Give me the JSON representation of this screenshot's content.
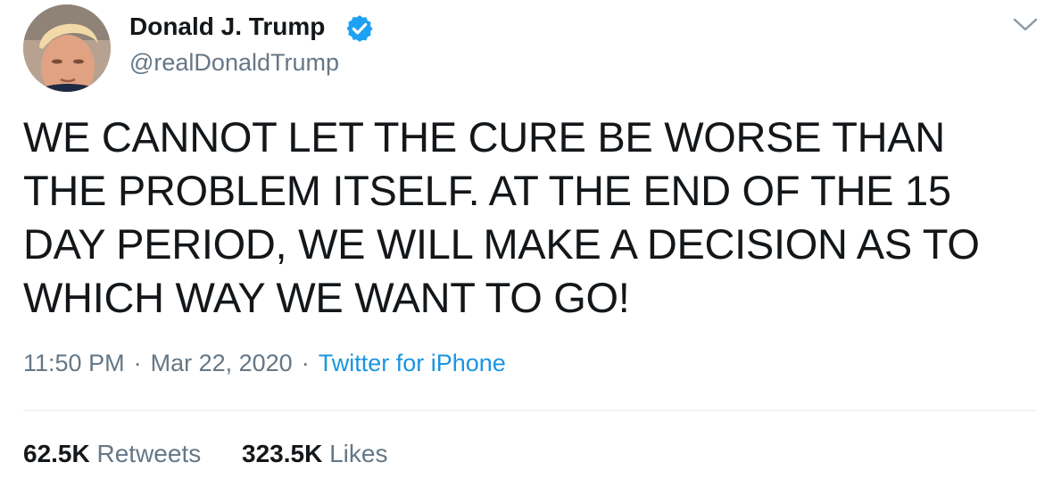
{
  "user": {
    "display_name": "Donald J. Trump",
    "handle": "@realDonaldTrump",
    "verified": true,
    "avatar_icon": "profile-photo"
  },
  "tweet": {
    "text": "WE CANNOT LET THE CURE BE WORSE THAN THE PROBLEM ITSELF. AT THE END OF THE 15 DAY PERIOD, WE WILL MAKE A DECISION AS TO WHICH WAY WE WANT TO GO!"
  },
  "meta": {
    "time": "11:50 PM",
    "separator": "·",
    "date": "Mar 22, 2020",
    "source": "Twitter for iPhone"
  },
  "stats": {
    "retweets_count": "62.5K",
    "retweets_label": "Retweets",
    "likes_count": "323.5K",
    "likes_label": "Likes"
  },
  "colors": {
    "text": "#14171a",
    "secondary": "#657786",
    "link": "#1b95e0",
    "verified": "#1da1f2",
    "divider": "#e6ecf0"
  },
  "icons": {
    "verified": "verified-badge-icon",
    "menu": "chevron-down-icon"
  }
}
